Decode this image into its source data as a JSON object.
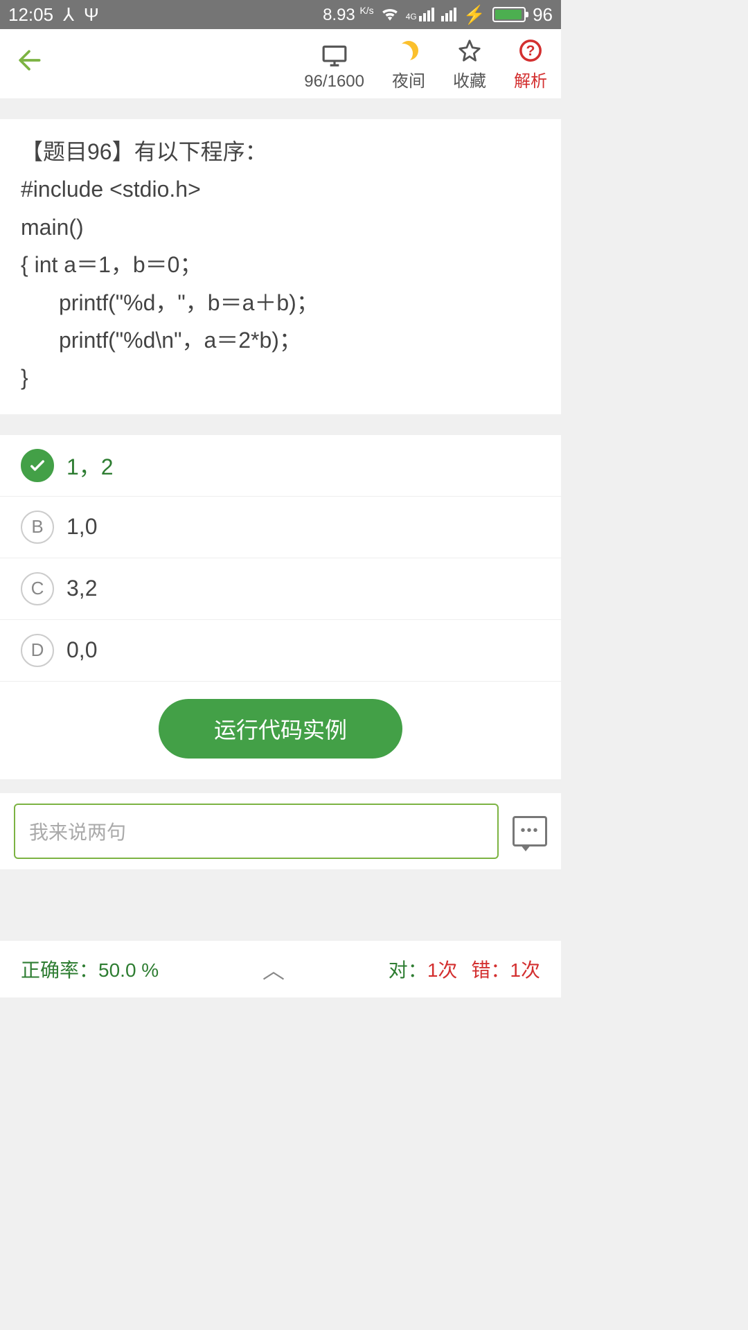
{
  "status_bar": {
    "time": "12:05",
    "speed_val": "8.93",
    "speed_unit": "K/s",
    "battery_pct": "96"
  },
  "header": {
    "progress": "96/1600",
    "night_mode": "夜间",
    "favorite": "收藏",
    "analysis": "解析"
  },
  "question": {
    "title": "【题目96】有以下程序：",
    "line1": "#include  <stdio.h>",
    "line2": "main()",
    "line3": "{    int  a＝1，b＝0；",
    "line4": "printf(\"%d，\"，b＝a＋b)；",
    "line5": "printf(\"%d\\n\"，a＝2*b)；",
    "line6": "}"
  },
  "answers": [
    {
      "letter": "",
      "text": "1，2",
      "correct": true
    },
    {
      "letter": "B",
      "text": "1,0",
      "correct": false
    },
    {
      "letter": "C",
      "text": "3,2",
      "correct": false
    },
    {
      "letter": "D",
      "text": "0,0",
      "correct": false
    }
  ],
  "run_button": "运行代码实例",
  "comment_placeholder": "我来说两句",
  "stats": {
    "rate_label": "正确率：",
    "rate_value": "50.0 %",
    "correct_label": "对：",
    "correct_value": "1次",
    "wrong_label": "错：",
    "wrong_value": "1次"
  }
}
